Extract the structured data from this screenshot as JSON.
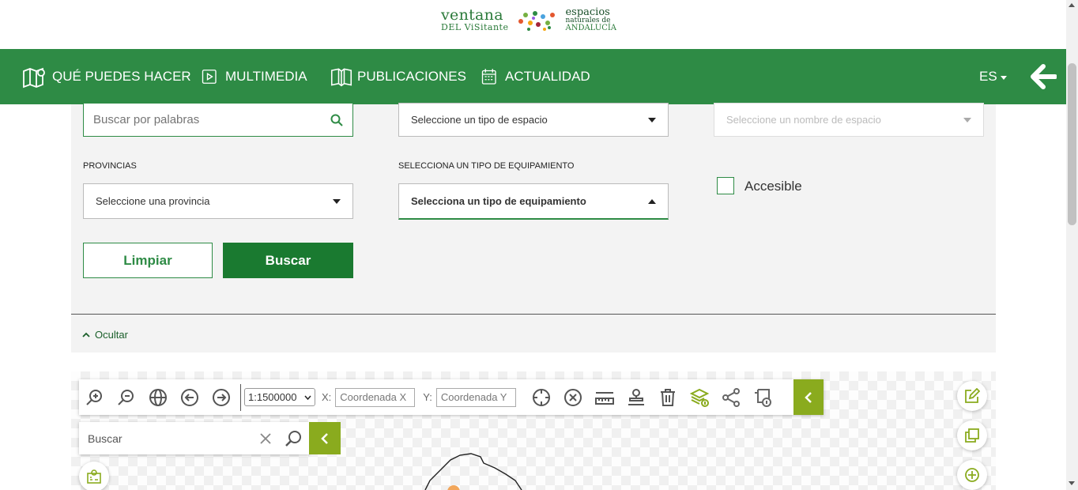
{
  "header": {
    "logo_ventana": "ventana",
    "logo_visitante": "DEL ViSitante",
    "logo_espacios": "espacios",
    "logo_naturales": "naturales de",
    "logo_andalucia": "ANDALUCÍA"
  },
  "nav": {
    "items": [
      {
        "label": "QUÉ PUEDES HACER",
        "icon": "map-pin-icon"
      },
      {
        "label": "MULTIMEDIA",
        "icon": "play-icon"
      },
      {
        "label": "PUBLICACIONES",
        "icon": "book-icon"
      },
      {
        "label": "ACTUALIDAD",
        "icon": "calendar-icon"
      }
    ],
    "language": "ES",
    "back_icon": "back-arrow-icon"
  },
  "filters": {
    "search_placeholder": "Buscar por palabras",
    "space_type_value": "Seleccione un tipo de espacio",
    "space_name_value": "Seleccione un nombre de espacio",
    "provinces_label": "PROVINCIAS",
    "province_value": "Seleccione una provincia",
    "equipment_label": "SELECCIONA UN TIPO DE EQUIPAMIENTO",
    "equipment_value": "Selecciona un tipo de equipamiento",
    "accessible_label": "Accesible",
    "clear_label": "Limpiar",
    "search_label": "Buscar",
    "hide_label": "Ocultar"
  },
  "map": {
    "scale_value": "1:1500000",
    "x_label": "X:",
    "y_label": "Y:",
    "x_placeholder": "Coordenada X",
    "y_placeholder": "Coordenada Y",
    "search_placeholder": "Buscar"
  },
  "colors": {
    "primary_green": "#2e8b45",
    "dark_green": "#1a7a30",
    "lime": "#8aab1e"
  }
}
